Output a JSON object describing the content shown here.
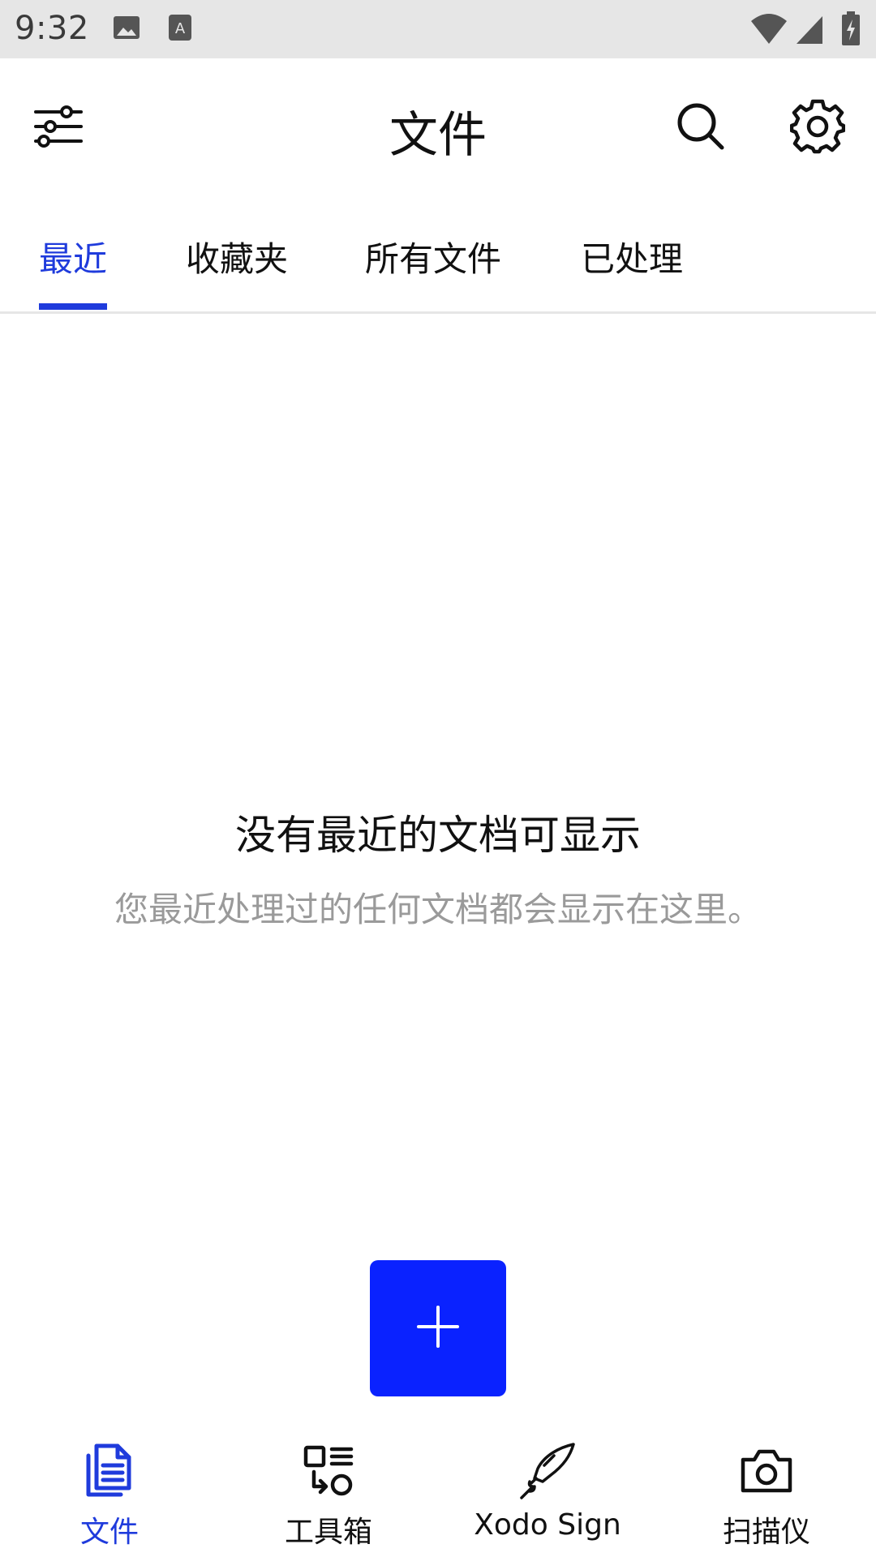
{
  "status_bar": {
    "time": "9:32",
    "icons": [
      "image-notification-icon",
      "keyboard-notification-icon",
      "wifi-icon",
      "signal-icon",
      "battery-charging-icon"
    ]
  },
  "app_bar": {
    "title": "文件",
    "left_icon": "filter-sliders-icon",
    "right_icons": [
      "search-icon",
      "settings-gear-icon"
    ]
  },
  "tabs": {
    "items": [
      {
        "label": "最近",
        "active": true
      },
      {
        "label": "收藏夹",
        "active": false
      },
      {
        "label": "所有文件",
        "active": false
      },
      {
        "label": "已处理",
        "active": false
      }
    ]
  },
  "empty_state": {
    "title": "没有最近的文档可显示",
    "subtitle": "您最近处理过的任何文档都会显示在这里。"
  },
  "fab": {
    "icon": "plus-icon"
  },
  "bottom_nav": {
    "items": [
      {
        "label": "文件",
        "icon": "document-icon",
        "active": true
      },
      {
        "label": "工具箱",
        "icon": "toolbox-icon",
        "active": false
      },
      {
        "label": "Xodo Sign",
        "icon": "pen-nib-icon",
        "active": false
      },
      {
        "label": "扫描仪",
        "icon": "camera-icon",
        "active": false
      }
    ]
  },
  "colors": {
    "accent": "#1f3bdc",
    "fab": "#0a22ff",
    "status_bar_bg": "#e6e6e6",
    "muted_text": "#9a9a9a"
  }
}
